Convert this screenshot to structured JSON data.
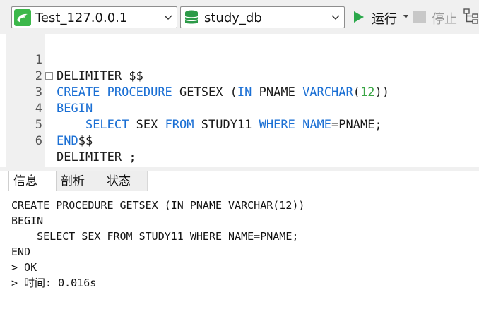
{
  "toolbar": {
    "connection": {
      "label": "Test_127.0.0.1",
      "icon": "dolphin-connection-icon"
    },
    "database": {
      "label": "study_db",
      "icon": "database-icon"
    },
    "run_label": "运行",
    "stop_label": "停止",
    "colors": {
      "run": "#2aa84a",
      "connection_icon_bg": "#3cb84a",
      "database_icon": "#2c9a48"
    }
  },
  "editor": {
    "lines": [
      {
        "num": "1",
        "tokens": [
          {
            "t": "DELIMITER $$",
            "c": ""
          }
        ]
      },
      {
        "num": "2",
        "tokens": [
          {
            "t": "CREATE",
            "c": "kw"
          },
          {
            "t": " ",
            "c": ""
          },
          {
            "t": "PROCEDURE",
            "c": "kw"
          },
          {
            "t": " GETSEX (",
            "c": ""
          },
          {
            "t": "IN",
            "c": "kw"
          },
          {
            "t": " PNAME ",
            "c": ""
          },
          {
            "t": "VARCHAR",
            "c": "kw"
          },
          {
            "t": "(",
            "c": ""
          },
          {
            "t": "12",
            "c": "num"
          },
          {
            "t": "))",
            "c": ""
          }
        ]
      },
      {
        "num": "3",
        "tokens": [
          {
            "t": "BEGIN",
            "c": "kw"
          }
        ]
      },
      {
        "num": "4",
        "tokens": [
          {
            "t": "    ",
            "c": ""
          },
          {
            "t": "SELECT",
            "c": "kw"
          },
          {
            "t": " SEX ",
            "c": ""
          },
          {
            "t": "FROM",
            "c": "kw"
          },
          {
            "t": " STUDY11 ",
            "c": ""
          },
          {
            "t": "WHERE",
            "c": "kw"
          },
          {
            "t": " ",
            "c": ""
          },
          {
            "t": "NAME",
            "c": "kw"
          },
          {
            "t": "=PNAME;",
            "c": ""
          }
        ]
      },
      {
        "num": "5",
        "tokens": [
          {
            "t": "END",
            "c": "kw"
          },
          {
            "t": "$$",
            "c": ""
          }
        ]
      },
      {
        "num": "6",
        "tokens": [
          {
            "t": "DELIMITER ;",
            "c": ""
          }
        ]
      }
    ]
  },
  "results": {
    "tabs": [
      {
        "label": "信息",
        "active": true
      },
      {
        "label": "剖析",
        "active": false
      },
      {
        "label": "状态",
        "active": false
      }
    ],
    "messages": [
      "CREATE PROCEDURE GETSEX (IN PNAME VARCHAR(12))",
      "BEGIN",
      "    SELECT SEX FROM STUDY11 WHERE NAME=PNAME;",
      "END",
      "> OK",
      "> 时间: 0.016s"
    ]
  }
}
